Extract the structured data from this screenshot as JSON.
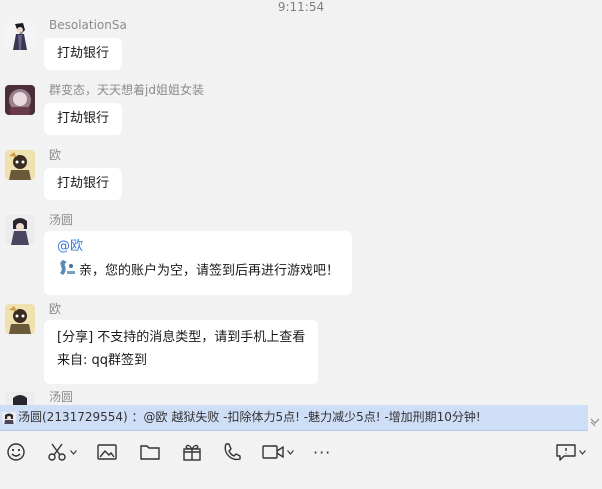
{
  "timestamp": "9:11:54",
  "messages": [
    {
      "sender": "BesolationSa",
      "lines": [
        "打劫银行"
      ]
    },
    {
      "sender": "群变态，天天想着jd姐姐女装",
      "lines": [
        "打劫银行"
      ]
    },
    {
      "sender": "欧",
      "lines": [
        "打劫银行"
      ]
    },
    {
      "sender": "汤圆",
      "mention": "@欧",
      "line": "亲，您的账户为空，请签到后再进行游戏吧！"
    },
    {
      "sender": "欧",
      "lines": [
        "[分享] 不支持的消息类型，请到手机上查看",
        "来自: qq群签到"
      ]
    },
    {
      "sender": "汤圆"
    }
  ],
  "notice": "汤圆(2131729554) ：@欧   越狱失败  -扣除体力5点!  -魅力减少5点!  -增加刑期10分钟!",
  "toolbar": {
    "icons": [
      "emoji-icon",
      "scissors-icon",
      "image-icon",
      "folder-icon",
      "gift-icon",
      "phone-icon",
      "video-icon",
      "more-icon",
      "chat-bubble-icon"
    ],
    "more_label": "···"
  }
}
